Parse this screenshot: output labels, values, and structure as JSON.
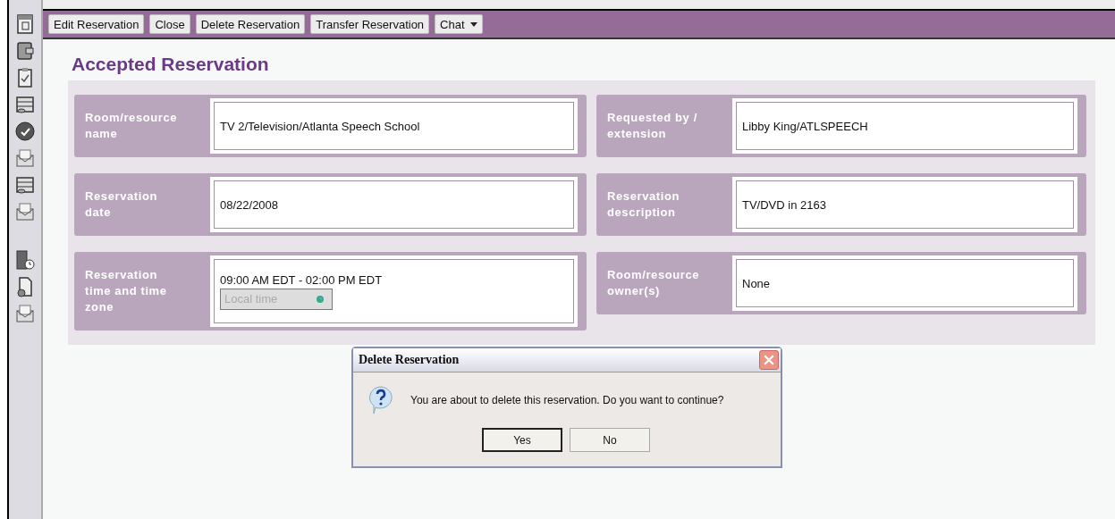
{
  "toolbar": {
    "buttons": [
      {
        "label": "Edit Reservation",
        "kind": "button"
      },
      {
        "label": "Close",
        "kind": "button"
      },
      {
        "label": "Delete Reservation",
        "kind": "button"
      },
      {
        "label": "Transfer Reservation",
        "kind": "button"
      },
      {
        "label": "Chat",
        "kind": "menu"
      }
    ]
  },
  "title": "Accepted Reservation",
  "fields": [
    {
      "label": "Room/resource name",
      "value": "TV 2/Television/Atlanta Speech School"
    },
    {
      "label": "Requested by / extension",
      "value": "Libby King/ATLSPEECH"
    },
    {
      "label": "Reservation date",
      "value": "08/22/2008"
    },
    {
      "label": "Reservation description",
      "value": "TV/DVD in 2163"
    },
    {
      "label": "Reservation time and time zone",
      "value": "09:00 AM EDT - 02:00 PM EDT",
      "timezone": {
        "value": "Local time",
        "disabled": true
      }
    },
    {
      "label": "Room/resource owner(s)",
      "value": "None"
    }
  ],
  "dialog": {
    "title": "Delete Reservation",
    "message": "You are about to delete this reservation. Do you want to continue?",
    "buttons": [
      {
        "label": "Yes",
        "default": true
      },
      {
        "label": "No",
        "default": false
      }
    ]
  }
}
